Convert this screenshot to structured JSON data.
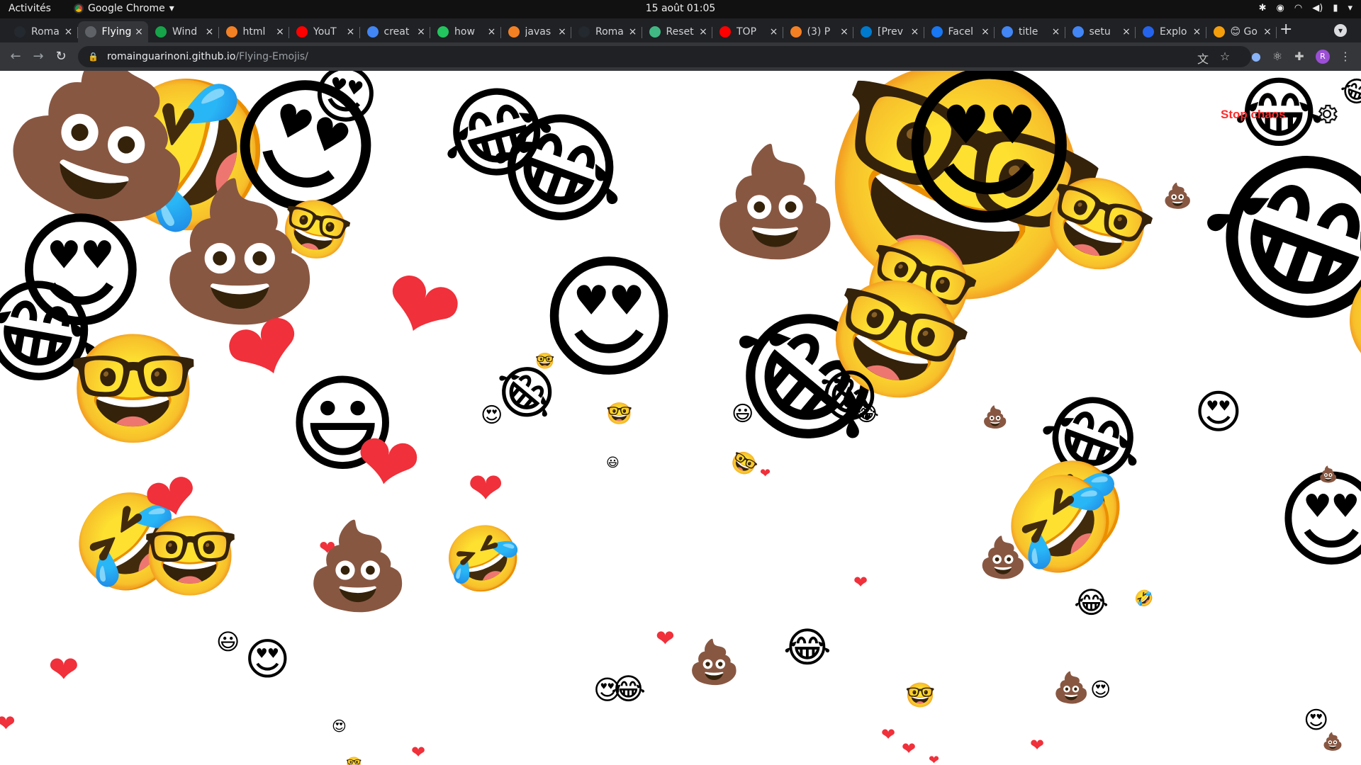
{
  "system_bar": {
    "activities": "Activités",
    "app_name": "Google Chrome",
    "clock": "15 août  01:05"
  },
  "browser": {
    "tabs": [
      {
        "title": "Roma",
        "favicon": "github-icon",
        "color": "#24292f",
        "active": false
      },
      {
        "title": "Flying",
        "favicon": "globe-icon",
        "color": "#5f6368",
        "active": true
      },
      {
        "title": "Wind",
        "favicon": "windmill-icon",
        "color": "#16a34a",
        "active": false
      },
      {
        "title": "html",
        "favicon": "stackoverflow-icon",
        "color": "#f48024",
        "active": false
      },
      {
        "title": "YouT",
        "favicon": "youtube-icon",
        "color": "#ff0000",
        "active": false
      },
      {
        "title": "creat",
        "favicon": "google-icon",
        "color": "#4285f4",
        "active": false
      },
      {
        "title": "how",
        "favicon": "codegrepper-icon",
        "color": "#22c55e",
        "active": false
      },
      {
        "title": "javas",
        "favicon": "stackoverflow-icon",
        "color": "#f48024",
        "active": false
      },
      {
        "title": "Roma",
        "favicon": "github-icon",
        "color": "#24292f",
        "active": false
      },
      {
        "title": "Reset",
        "favicon": "vue-icon",
        "color": "#41b883",
        "active": false
      },
      {
        "title": "TOP",
        "favicon": "youtube-icon",
        "color": "#ff0000",
        "active": false
      },
      {
        "title": "(3) P",
        "favicon": "stackoverflow-icon",
        "color": "#f48024",
        "active": false
      },
      {
        "title": "[Prev",
        "favicon": "vscode-icon",
        "color": "#007acc",
        "active": false
      },
      {
        "title": "Facel",
        "favicon": "facebook-icon",
        "color": "#1877f2",
        "active": false
      },
      {
        "title": "title",
        "favicon": "google-icon",
        "color": "#4285f4",
        "active": false
      },
      {
        "title": "setu",
        "favicon": "google-icon",
        "color": "#4285f4",
        "active": false
      },
      {
        "title": "Explo",
        "favicon": "explorer-icon",
        "color": "#2563eb",
        "active": false
      },
      {
        "title": "😊 Go",
        "favicon": "smile-icon",
        "color": "#f59e0b",
        "active": false
      }
    ],
    "url_host": "romainguarinoni.github.io",
    "url_path": "/Flying-Emojis/"
  },
  "page": {
    "stop_label": "Stop chaos",
    "stop_color": "#ff2b2b"
  },
  "emoji_glyphs": {
    "poop": "💩",
    "heart_eyes": "😍",
    "nerd": "🤓",
    "laughing": "😂",
    "rofl": "🤣",
    "grin": "😃",
    "heart": "❤"
  }
}
